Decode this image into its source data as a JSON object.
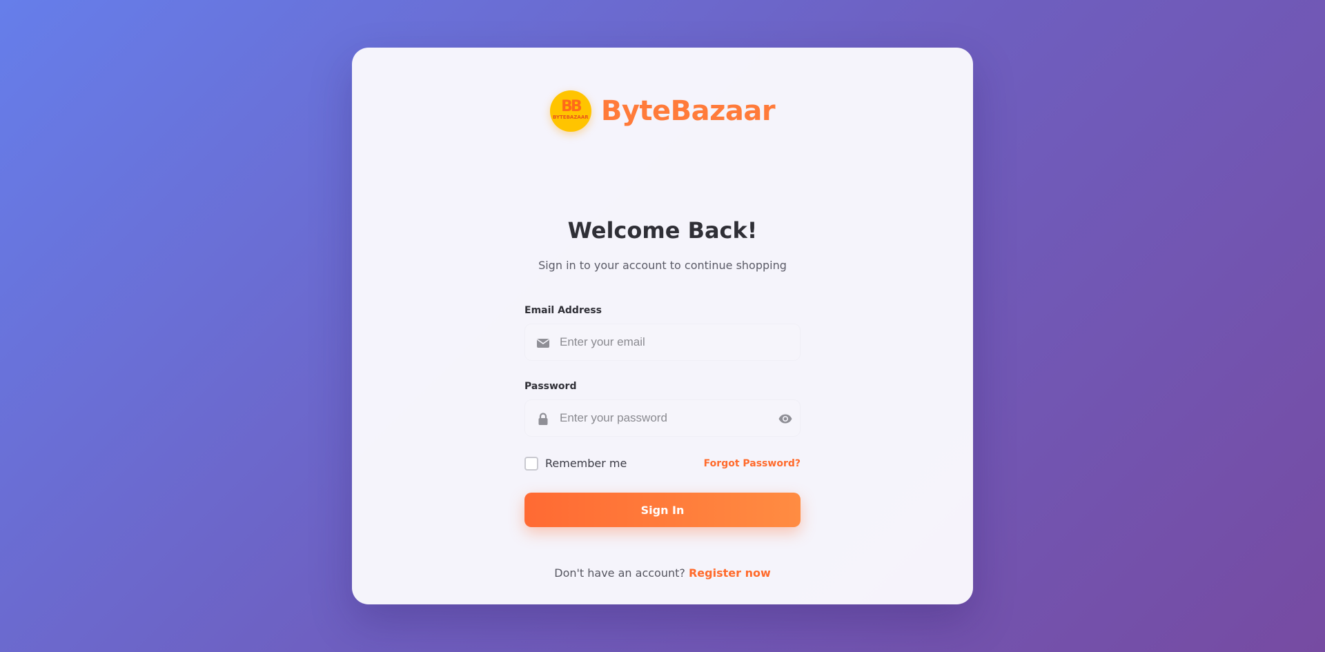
{
  "brand": {
    "logo_mark": "BB",
    "logo_sub": "BYTEBAZAAR",
    "name": "ByteBazaar"
  },
  "heading": {
    "title": "Welcome Back!",
    "subtitle": "Sign in to your account to continue shopping"
  },
  "form": {
    "email": {
      "label": "Email Address",
      "placeholder": "Enter your email",
      "icon": "envelope-icon"
    },
    "password": {
      "label": "Password",
      "placeholder": "Enter your password",
      "icon": "lock-icon",
      "toggle_icon": "eye-icon"
    },
    "remember_label": "Remember me",
    "forgot_label": "Forgot Password?",
    "submit_label": "Sign In"
  },
  "footer": {
    "prompt": "Don't have an account?",
    "register_label": "Register now"
  },
  "colors": {
    "accent": "#ff6a2b",
    "brand_text": "#ff7b3a",
    "logo_bg": "#ffc400",
    "background_start": "#667eea",
    "background_end": "#764ba2"
  }
}
